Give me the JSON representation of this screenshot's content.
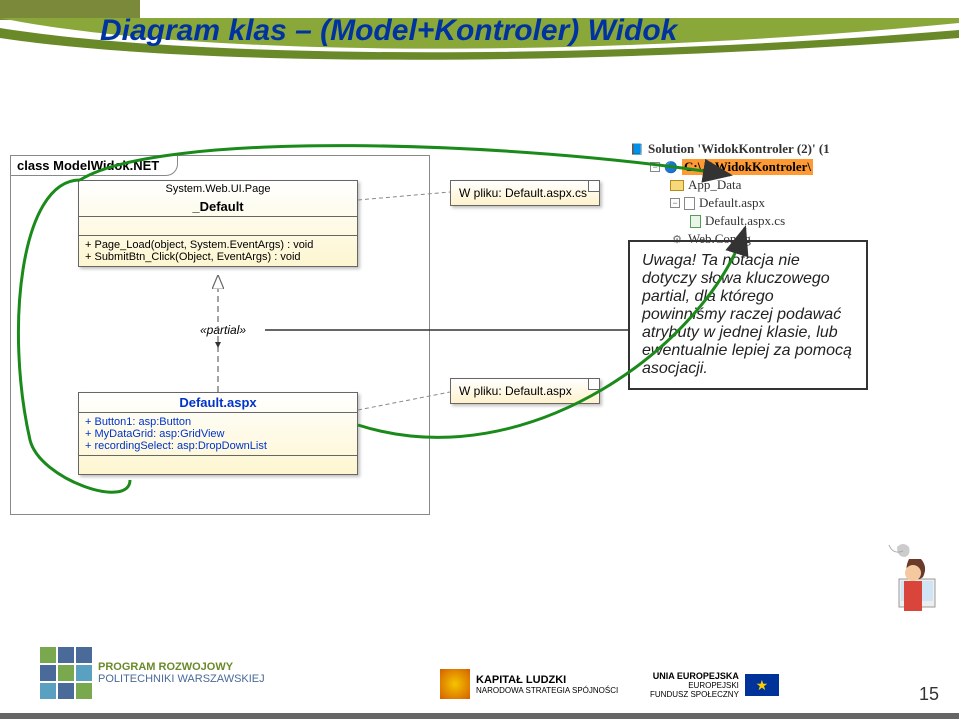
{
  "title": "Diagram klas – (Model+Kontroler) Widok",
  "outer_label": "class ModelWidok.NET",
  "class1": {
    "stereotype_top": "System.Web.UI.Page",
    "name": "_Default",
    "ops": [
      "+   Page_Load(object, System.EventArgs) : void",
      "+   SubmitBtn_Click(Object, EventArgs) : void"
    ]
  },
  "partial_label": "«partial»",
  "class2": {
    "name": "Default.aspx",
    "attrs": [
      "+   Button1:  asp:Button",
      "+   MyDataGrid:  asp:GridView",
      "+   recordingSelect:  asp:DropDownList"
    ]
  },
  "note1": "W pliku: Default.aspx.cs",
  "note2": "W pliku: Default.aspx",
  "callout": "Uwaga! Ta notacja nie dotyczy słowa kluczowego partial, dla którego powinniśmy raczej podawać atrybuty w jednej klasie, lub ewentualnie lepiej za pomocą asocjacji.",
  "tree": {
    "root": "Solution 'WidokKontroler (2)' (1",
    "proj": "C:\\...\\WidokKontroler\\",
    "items": [
      "App_Data",
      "Default.aspx",
      "Default.aspx.cs",
      "Web.Config"
    ]
  },
  "footer": {
    "prl1": "PROGRAM ROZWOJOWY",
    "prl2": "POLITECHNIKI WARSZAWSKIEJ",
    "kl1": "KAPITAŁ LUDZKI",
    "kl2": "NARODOWA STRATEGIA SPÓJNOŚCI",
    "eu1": "UNIA EUROPEJSKA",
    "eu2": "EUROPEJSKI",
    "eu3": "FUNDUSZ SPOŁECZNY",
    "page": "15"
  },
  "chart_data": {
    "type": "uml_class_diagram",
    "package": "ModelWidok.NET",
    "classes": [
      {
        "name": "_Default",
        "stereotype_or_parent": "System.Web.UI.Page",
        "compartments": {
          "attributes": [],
          "operations": [
            {
              "visibility": "+",
              "signature": "Page_Load(object, System.EventArgs) : void"
            },
            {
              "visibility": "+",
              "signature": "SubmitBtn_Click(Object, EventArgs) : void"
            }
          ]
        },
        "note": "W pliku: Default.aspx.cs"
      },
      {
        "name": "Default.aspx",
        "compartments": {
          "attributes": [
            {
              "visibility": "+",
              "name": "Button1",
              "type": "asp:Button"
            },
            {
              "visibility": "+",
              "name": "MyDataGrid",
              "type": "asp:GridView"
            },
            {
              "visibility": "+",
              "name": "recordingSelect",
              "type": "asp:DropDownList"
            }
          ],
          "operations": []
        },
        "note": "W pliku: Default.aspx"
      }
    ],
    "relationships": [
      {
        "from": "Default.aspx",
        "to": "_Default",
        "type": "realization",
        "label": "«partial»"
      }
    ],
    "annotation": "Uwaga! Ta notacja nie dotyczy słowa kluczowego partial, dla którego powinniśmy raczej podawać atrybuty w jednej klasie, lub ewentualnie lepiej za pomocą asocjacji.",
    "solution_tree": {
      "solution": "WidokKontroler (2)",
      "project_path": "C:\\...\\WidokKontroler\\",
      "children": [
        "App_Data",
        "Default.aspx",
        "Default.aspx.cs",
        "Web.Config"
      ]
    }
  }
}
